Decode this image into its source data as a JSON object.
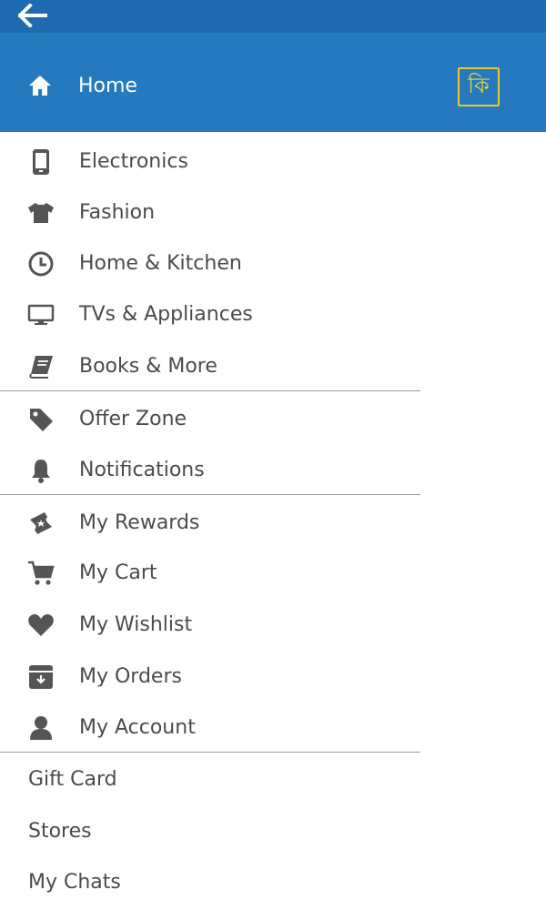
{
  "header": {
    "home_label": "Home",
    "language_glyph": "কি",
    "accent_color": "#2579bf",
    "status_color": "#1f6bb1",
    "language_border_color": "#e8c935"
  },
  "categories": [
    {
      "label": "Electronics",
      "icon": "phone-icon"
    },
    {
      "label": "Fashion",
      "icon": "tshirt-icon"
    },
    {
      "label": "Home & Kitchen",
      "icon": "clock-icon"
    },
    {
      "label": "TVs & Appliances",
      "icon": "monitor-icon"
    },
    {
      "label": "Books & More",
      "icon": "book-icon"
    }
  ],
  "offers": [
    {
      "label": "Offer Zone",
      "icon": "tag-icon"
    },
    {
      "label": "Notifications",
      "icon": "bell-icon"
    }
  ],
  "account": [
    {
      "label": "My Rewards",
      "icon": "ticket-icon"
    },
    {
      "label": "My Cart",
      "icon": "cart-icon"
    },
    {
      "label": "My Wishlist",
      "icon": "heart-icon"
    },
    {
      "label": "My Orders",
      "icon": "archive-icon"
    },
    {
      "label": "My Account",
      "icon": "user-icon"
    }
  ],
  "misc": [
    {
      "label": "Gift Card"
    },
    {
      "label": "Stores"
    },
    {
      "label": "My Chats"
    }
  ]
}
